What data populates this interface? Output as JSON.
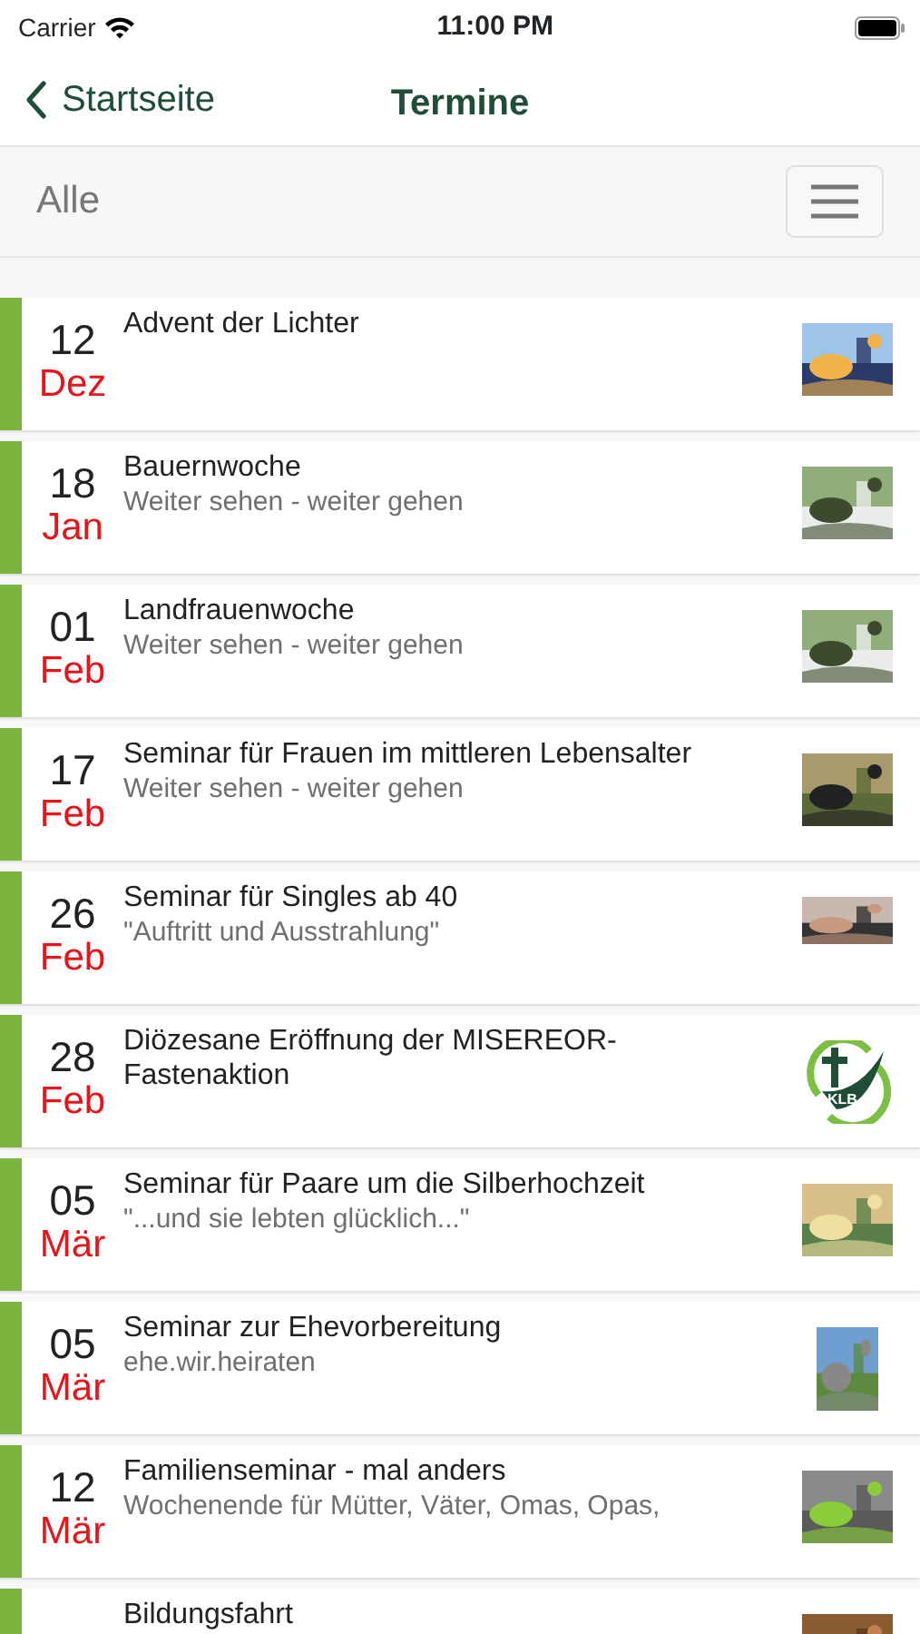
{
  "status_bar": {
    "carrier": "Carrier",
    "time": "11:00 PM"
  },
  "nav": {
    "back": "Startseite",
    "title": "Termine"
  },
  "filter": {
    "label": "Alle"
  },
  "events": [
    {
      "day": "12",
      "month": "Dez",
      "title": "Advent der Lichter"
    },
    {
      "day": "18",
      "month": "Jan",
      "title": "Bauernwoche",
      "subtitle": "Weiter sehen - weiter gehen"
    },
    {
      "day": "01",
      "month": "Feb",
      "title": "Landfrauenwoche",
      "subtitle": "Weiter sehen - weiter gehen"
    },
    {
      "day": "17",
      "month": "Feb",
      "title": "Seminar für Frauen im mittleren Lebensalter",
      "subtitle": "Weiter sehen - weiter gehen"
    },
    {
      "day": "26",
      "month": "Feb",
      "title": "Seminar für Singles ab 40",
      "subtitle": "\"Auftritt und Ausstrahlung\""
    },
    {
      "day": "28",
      "month": "Feb",
      "title": "Diözesane Eröffnung der MISEREOR-Fastenaktion",
      "thumb": {
        "kind": "logo",
        "text": "KLB"
      }
    },
    {
      "day": "05",
      "month": "Mär",
      "title": "Seminar für Paare um die Silberhochzeit",
      "subtitle": "\"...und sie lebten glücklich...\""
    },
    {
      "day": "05",
      "month": "Mär",
      "title": "Seminar zur Ehevorbereitung",
      "subtitle": "ehe.wir.heiraten"
    },
    {
      "day": "12",
      "month": "Mär",
      "title": "Familienseminar - mal anders",
      "subtitle": "Wochenende für Mütter, Väter, Omas, Opas,"
    },
    {
      "title": "Bildungsfahrt"
    }
  ]
}
